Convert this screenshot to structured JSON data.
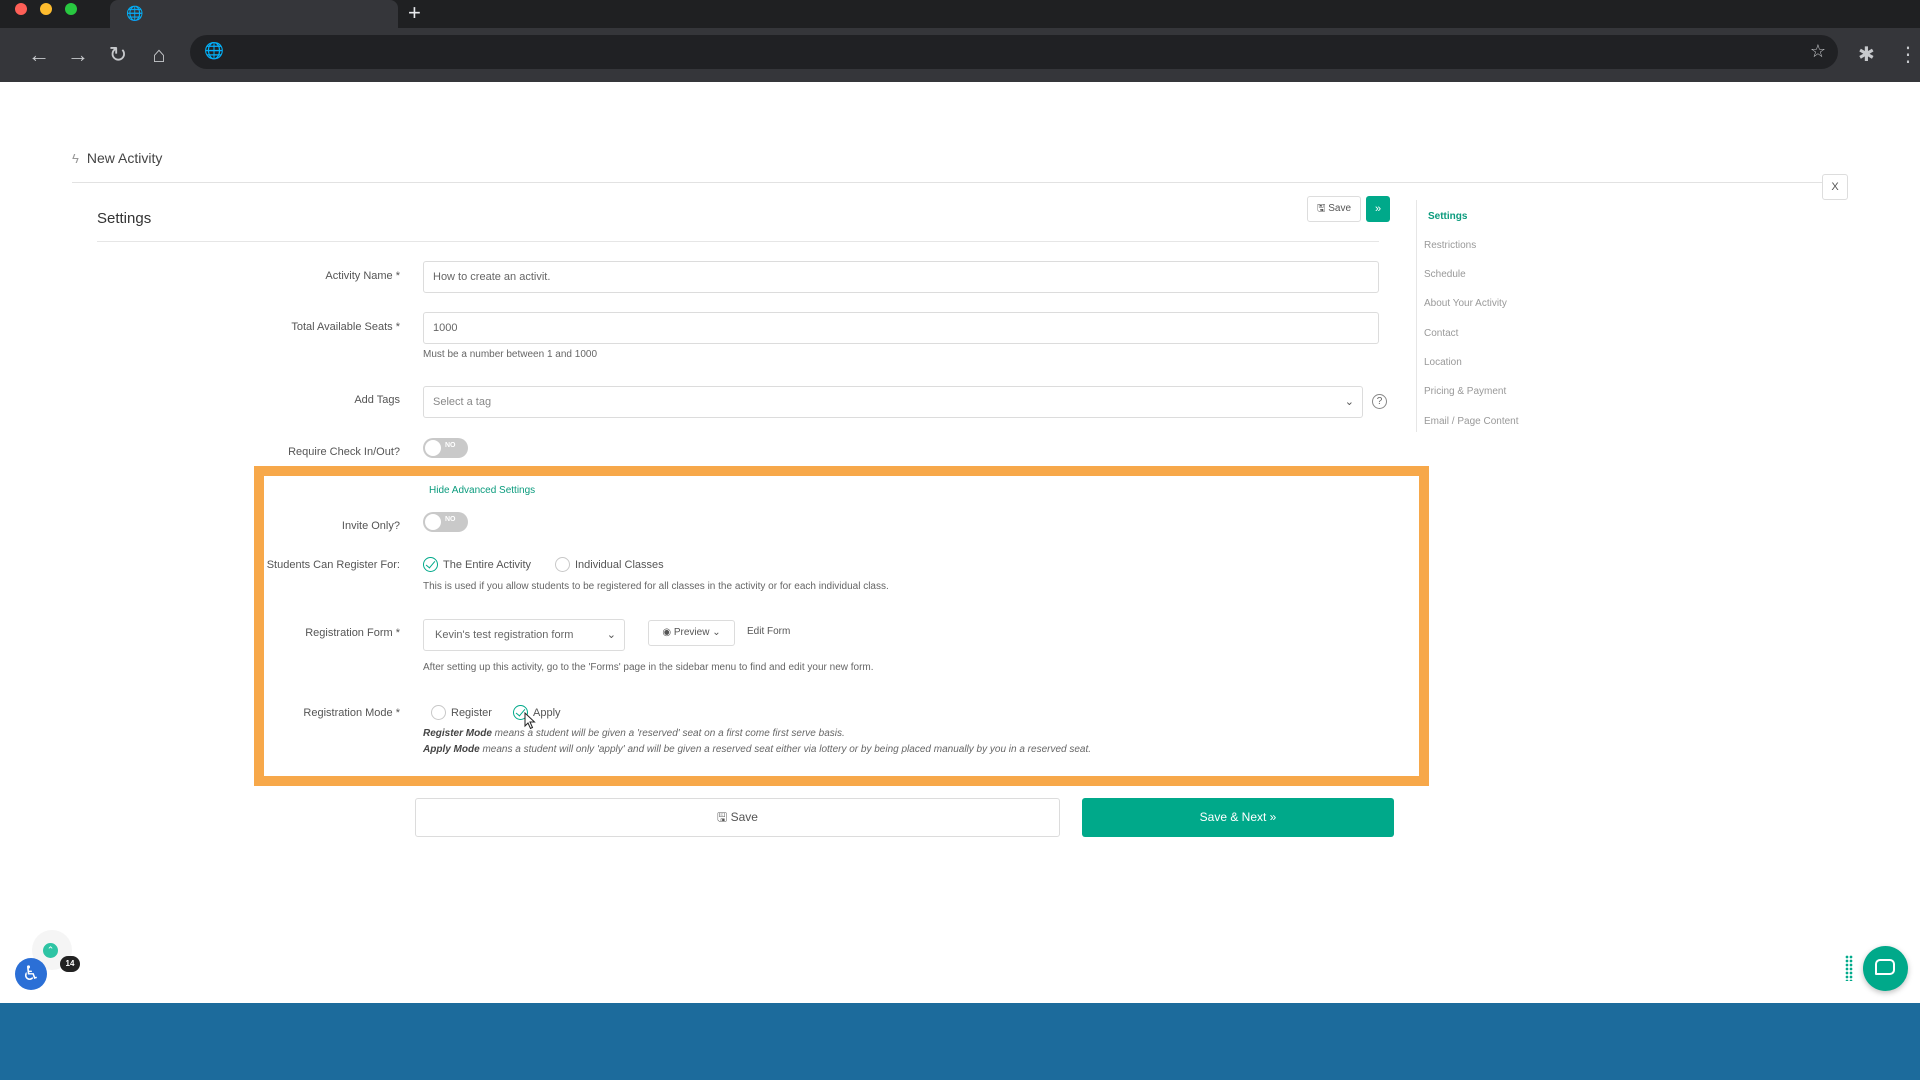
{
  "browser": {
    "globe_glyph": "🌐",
    "new_tab_glyph": "+",
    "back_glyph": "←",
    "forward_glyph": "→",
    "reload_glyph": "↻",
    "home_glyph": "⌂",
    "star_glyph": "☆",
    "extensions_glyph": "✱",
    "menu_glyph": "⋮"
  },
  "page": {
    "title": "New Activity",
    "close_label": "X"
  },
  "section": {
    "title": "Settings",
    "save_label": "Save",
    "next_label": "»"
  },
  "form": {
    "activity_name": {
      "label": "Activity Name *",
      "value": "How to create an activit."
    },
    "seats": {
      "label": "Total Available Seats *",
      "value": "1000",
      "help": "Must be a number between 1 and 1000"
    },
    "tags": {
      "label": "Add Tags",
      "placeholder": "Select a tag",
      "help_glyph": "?"
    },
    "check_in": {
      "label": "Require Check In/Out?",
      "toggle": "NO"
    },
    "advanced_link": "Hide Advanced Settings",
    "invite_only": {
      "label": "Invite Only?",
      "toggle": "NO"
    },
    "register_for": {
      "label": "Students Can Register For:",
      "options": [
        "The Entire Activity",
        "Individual Classes"
      ],
      "selected": "The Entire Activity",
      "help": "This is used if you allow students to be registered for all classes in the activity or for each individual class."
    },
    "registration_form": {
      "label": "Registration Form *",
      "value": "Kevin's test registration form",
      "preview_label": "Preview",
      "edit_label": "Edit Form",
      "help": "After setting up this activity, go to the 'Forms' page in the sidebar menu to find and edit your new form."
    },
    "registration_mode": {
      "label": "Registration Mode *",
      "options": [
        "Register",
        "Apply"
      ],
      "selected": "Apply",
      "desc_register_term": "Register Mode",
      "desc_register": " means a student will be given a 'reserved' seat on a first come first serve basis.",
      "desc_apply_term": "Apply Mode",
      "desc_apply": " means a student will only 'apply' and will be given a reserved seat either via lottery or by being placed manually by you in a reserved seat."
    },
    "save_label": "Save",
    "save_next_label": "Save & Next »"
  },
  "sidebar": {
    "items": [
      {
        "label": "Settings",
        "active": true
      },
      {
        "label": "Restrictions"
      },
      {
        "label": "Schedule"
      },
      {
        "label": "About Your Activity"
      },
      {
        "label": "Contact"
      },
      {
        "label": "Location"
      },
      {
        "label": "Pricing & Payment"
      },
      {
        "label": "Email / Page Content"
      }
    ]
  },
  "widgets": {
    "notification_count": "14",
    "accessibility_glyph": "♿",
    "up_glyph": "⌃"
  },
  "colors": {
    "accent": "#00a98a",
    "highlight": "#f7a84a",
    "footer": "#1c6b9c"
  }
}
